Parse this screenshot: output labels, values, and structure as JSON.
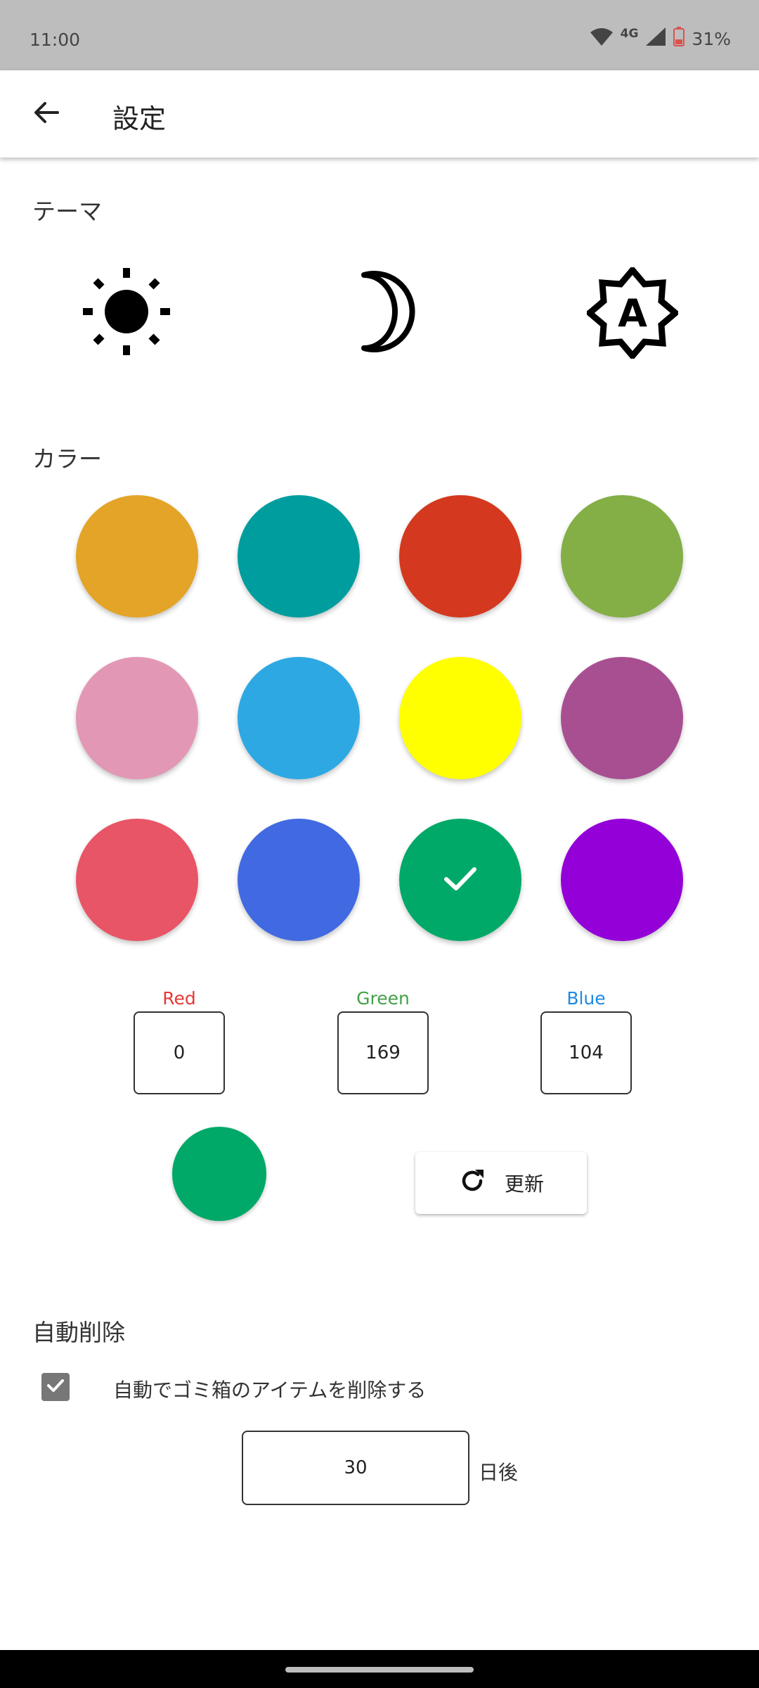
{
  "status_bar": {
    "time": "11:00",
    "network": "4G",
    "battery": "31%",
    "icons": [
      "wifi-icon",
      "signal-icon",
      "battery-icon"
    ]
  },
  "app_bar": {
    "title": "設定",
    "back_icon": "arrow-back-icon"
  },
  "theme": {
    "label": "テーマ",
    "options": [
      {
        "name": "light",
        "icon": "sun-icon"
      },
      {
        "name": "dark",
        "icon": "moon-icon"
      },
      {
        "name": "auto",
        "icon": "brightness-auto-icon",
        "glyph": "A"
      }
    ]
  },
  "color": {
    "label": "カラー",
    "swatches": [
      {
        "hex": "#E3A427"
      },
      {
        "hex": "#009D9E"
      },
      {
        "hex": "#D4381E"
      },
      {
        "hex": "#83AF46"
      },
      {
        "hex": "#E298B5"
      },
      {
        "hex": "#2EA8E3"
      },
      {
        "hex": "#FFFF00"
      },
      {
        "hex": "#A84F92"
      },
      {
        "hex": "#E85566"
      },
      {
        "hex": "#4169E1"
      },
      {
        "hex": "#00A968",
        "selected": true
      },
      {
        "hex": "#9400D8"
      }
    ],
    "rgb": {
      "red_label": "Red",
      "red_value": "0",
      "red_color": "#E53935",
      "green_label": "Green",
      "green_value": "169",
      "green_color": "#43A047",
      "blue_label": "Blue",
      "blue_value": "104",
      "blue_color": "#1E88E5"
    },
    "preview_hex": "#00A968",
    "update_label": "更新",
    "update_icon": "refresh-icon"
  },
  "auto_delete": {
    "label": "自動削除",
    "checkbox_checked": true,
    "checkbox_label": "自動でゴミ箱のアイテムを削除する",
    "days_value": "30",
    "days_suffix": "日後"
  }
}
